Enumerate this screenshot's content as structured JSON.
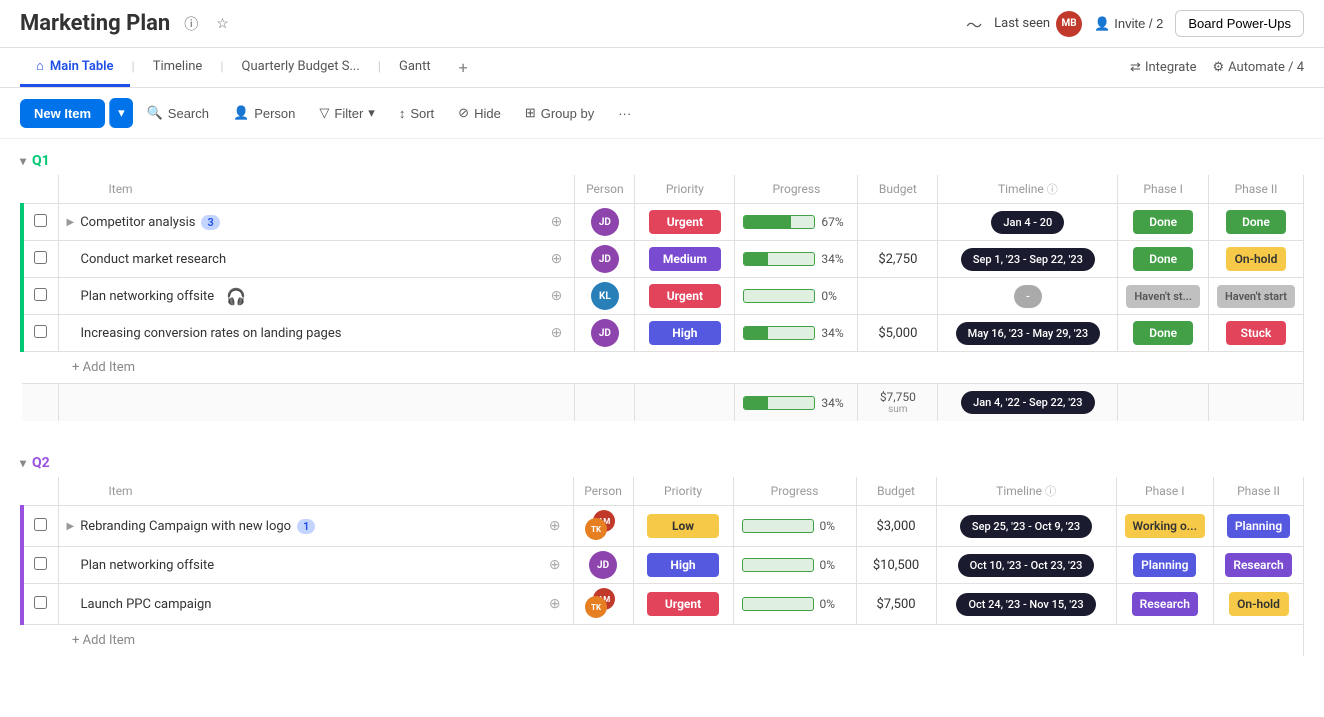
{
  "header": {
    "title": "Marketing Plan",
    "last_seen_label": "Last seen",
    "invite_label": "Invite / 2",
    "board_powerups_label": "Board Power-Ups",
    "trend_icon": "trend-icon",
    "info_icon": "info-icon",
    "star_icon": "star-icon",
    "user_icon": "user-icon"
  },
  "tabs": {
    "items": [
      {
        "label": "Main Table",
        "active": true
      },
      {
        "label": "Timeline",
        "active": false
      },
      {
        "label": "Quarterly Budget S...",
        "active": false
      },
      {
        "label": "Gantt",
        "active": false
      }
    ],
    "add_label": "+",
    "integrate_label": "Integrate",
    "automate_label": "Automate / 4"
  },
  "toolbar": {
    "new_item_label": "New Item",
    "search_label": "Search",
    "person_label": "Person",
    "filter_label": "Filter",
    "sort_label": "Sort",
    "hide_label": "Hide",
    "group_by_label": "Group by",
    "more_label": "···"
  },
  "sections": [
    {
      "id": "q1",
      "label": "Q1",
      "color": "#00c875",
      "columns": [
        "Item",
        "Person",
        "Priority",
        "Progress",
        "Budget",
        "Timeline",
        "Phase I",
        "Phase II"
      ],
      "rows": [
        {
          "id": 1,
          "item": "Competitor analysis",
          "expandable": true,
          "badge": "3",
          "person": "av1",
          "priority": "Urgent",
          "priority_class": "priority-urgent",
          "progress": 67,
          "budget": "",
          "timeline": "Jan 4 - 20",
          "timeline_class": "timeline-badge",
          "phase1": "Done",
          "phase1_class": "phase-done",
          "phase2": "Done",
          "phase2_class": "phase-done"
        },
        {
          "id": 2,
          "item": "Conduct market research",
          "expandable": false,
          "badge": "",
          "person": "av1",
          "priority": "Medium",
          "priority_class": "priority-medium",
          "progress": 34,
          "budget": "$2,750",
          "timeline": "Sep 1, '23 - Sep 22, '23",
          "timeline_class": "timeline-badge",
          "phase1": "Done",
          "phase1_class": "phase-done",
          "phase2": "On-hold",
          "phase2_class": "phase-onhold"
        },
        {
          "id": 3,
          "item": "Plan networking offsite",
          "expandable": false,
          "badge": "",
          "person": "av2",
          "priority": "Urgent",
          "priority_class": "priority-urgent",
          "progress": 0,
          "budget": "",
          "timeline": "-",
          "timeline_class": "timeline-badge grey",
          "phase1": "Haven't st...",
          "phase1_class": "phase-havent",
          "phase2": "Haven't start",
          "phase2_class": "phase-havent"
        },
        {
          "id": 4,
          "item": "Increasing conversion rates on landing pages",
          "expandable": false,
          "badge": "",
          "person": "av1",
          "priority": "High",
          "priority_class": "priority-high",
          "progress": 34,
          "budget": "$5,000",
          "timeline": "May 16, '23 - May 29, '23",
          "timeline_class": "timeline-badge",
          "phase1": "Done",
          "phase1_class": "phase-done",
          "phase2": "Stuck",
          "phase2_class": "phase-stuck"
        }
      ],
      "summary": {
        "progress": 34,
        "budget": "$7,750",
        "budget_label": "sum",
        "timeline": "Jan 4, '22 - Sep 22, '23"
      },
      "add_item_label": "+ Add Item"
    },
    {
      "id": "q2",
      "label": "Q2",
      "color": "#9b51e0",
      "columns": [
        "Item",
        "Person",
        "Priority",
        "Progress",
        "Budget",
        "Timeline",
        "Phase I",
        "Phase II"
      ],
      "rows": [
        {
          "id": 5,
          "item": "Rebranding Campaign with new logo",
          "expandable": true,
          "badge": "1",
          "person": "av-multi",
          "priority": "Low",
          "priority_class": "priority-low",
          "progress": 0,
          "budget": "$3,000",
          "timeline": "Sep 25, '23 - Oct 9, '23",
          "timeline_class": "timeline-badge",
          "phase1": "Working o...",
          "phase1_class": "phase-working",
          "phase2": "Planning",
          "phase2_class": "phase-planning"
        },
        {
          "id": 6,
          "item": "Plan networking offsite",
          "expandable": false,
          "badge": "",
          "person": "av1",
          "priority": "High",
          "priority_class": "priority-high",
          "progress": 0,
          "budget": "$10,500",
          "timeline": "Oct 10, '23 - Oct 23, '23",
          "timeline_class": "timeline-badge",
          "phase1": "Planning",
          "phase1_class": "phase-planning",
          "phase2": "Research",
          "phase2_class": "phase-research"
        },
        {
          "id": 7,
          "item": "Launch PPC campaign",
          "expandable": false,
          "badge": "",
          "person": "av-multi2",
          "priority": "Urgent",
          "priority_class": "priority-urgent",
          "progress": 0,
          "budget": "$7,500",
          "timeline": "Oct 24, '23 - Nov 15, '23",
          "timeline_class": "timeline-badge",
          "phase1": "Research",
          "phase1_class": "phase-research",
          "phase2": "On-hold",
          "phase2_class": "phase-onhold"
        }
      ],
      "add_item_label": "+ Add Item"
    }
  ]
}
